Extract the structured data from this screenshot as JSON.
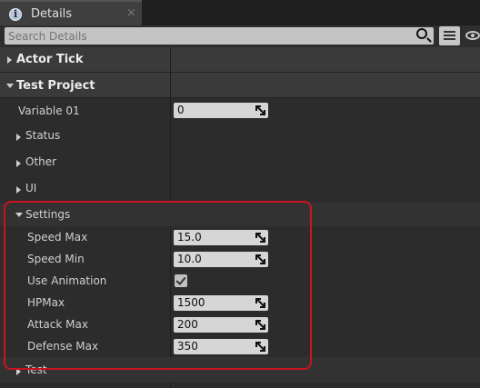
{
  "tab": {
    "label": "Details",
    "close": "×",
    "icon": "info-icon"
  },
  "search": {
    "placeholder": "Search Details"
  },
  "categories": {
    "actor_tick": "Actor Tick",
    "test_project": "Test Project"
  },
  "test_project": {
    "variable01": {
      "label": "Variable 01",
      "value": "0"
    },
    "status": "Status",
    "other": "Other",
    "ui": "UI",
    "settings": "Settings",
    "test": "Test"
  },
  "settings": {
    "speed_max": {
      "label": "Speed Max",
      "value": "15.0"
    },
    "speed_min": {
      "label": "Speed Min",
      "value": "10.0"
    },
    "use_animation": {
      "label": "Use Animation",
      "checked": true
    },
    "hp_max": {
      "label": "HPMax",
      "value": "1500"
    },
    "attack_max": {
      "label": "Attack Max",
      "value": "200"
    },
    "defense_max": {
      "label": "Defense Max",
      "value": "350"
    }
  },
  "colors": {
    "highlight": "#c8141e",
    "panel": "#2c2c2c",
    "category": "#3a3a3a"
  }
}
